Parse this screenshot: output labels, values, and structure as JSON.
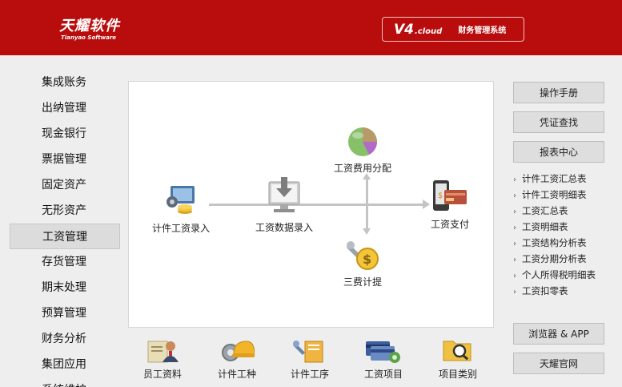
{
  "header": {
    "logo_cn": "天耀软件",
    "logo_en": "Tianyao Software",
    "version_main": "V4",
    "version_sub": ".cloud",
    "system_name": "财务管理系统"
  },
  "nav": {
    "items": [
      {
        "label": "集成账务"
      },
      {
        "label": "出纳管理"
      },
      {
        "label": "现金银行"
      },
      {
        "label": "票据管理"
      },
      {
        "label": "固定资产"
      },
      {
        "label": "无形资产"
      },
      {
        "label": "工资管理"
      },
      {
        "label": "存货管理"
      },
      {
        "label": "期末处理"
      },
      {
        "label": "预算管理"
      },
      {
        "label": "财务分析"
      },
      {
        "label": "集团应用"
      },
      {
        "label": "系统维护"
      }
    ],
    "active": "工资管理"
  },
  "flow": {
    "piece_entry": "计件工资录入",
    "data_entry": "工资数据录入",
    "allocation": "工资费用分配",
    "payment": "工资支付",
    "three_fees": "三费计提"
  },
  "shortcuts": {
    "employee": "员工资料",
    "work_type": "计件工种",
    "process": "计件工序",
    "salary_item": "工资项目",
    "project_category": "项目类别"
  },
  "right": {
    "manual": "操作手册",
    "voucher": "凭证查找",
    "report_center": "报表中心",
    "reports": [
      {
        "label": "计件工资汇总表"
      },
      {
        "label": "计件工资明细表"
      },
      {
        "label": "工资汇总表"
      },
      {
        "label": "工资明细表"
      },
      {
        "label": "工资结构分析表"
      },
      {
        "label": "工资分期分析表"
      },
      {
        "label": "个人所得税明细表"
      },
      {
        "label": "工资扣零表"
      }
    ],
    "browser_app": "浏览器 & APP",
    "website": "天耀官网"
  },
  "colors": {
    "brand_red": "#b90d0d",
    "background": "#eeeeee"
  }
}
